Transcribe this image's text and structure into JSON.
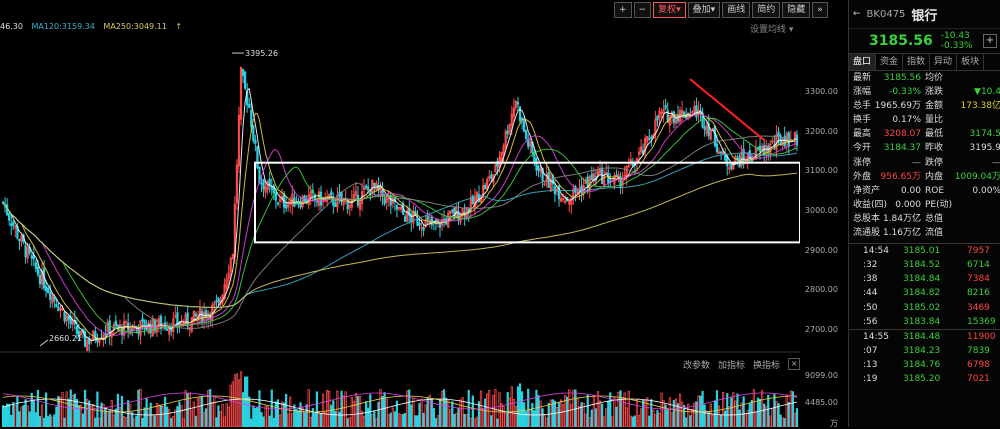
{
  "ma_labels": [
    {
      "text": "46.30",
      "color": "#e0e0e0"
    },
    {
      "text": "MA120:3159.34",
      "color": "#3bb3c9"
    },
    {
      "text": "MA250:3049.11",
      "color": "#d8cc60"
    },
    {
      "text": "↑",
      "color": "#d8cc60"
    }
  ],
  "toolbar": {
    "plus": "+",
    "minus": "−",
    "fq": "复权",
    "fq_arrow": "▾",
    "overlay": "叠加",
    "overlay_arrow": "▾",
    "line": "画线",
    "simple": "简约",
    "hide": "隐藏",
    "more": "»"
  },
  "settings_label": "设置均线 ▾",
  "high_label": "3395.26",
  "low_label": "2660.21",
  "price_ticks": [
    "3300.00",
    "3200.00",
    "3100.00",
    "3000.00",
    "2900.00",
    "2800.00",
    "2700.00"
  ],
  "volume_ticks": [
    "9099.00",
    "4485.00",
    "万"
  ],
  "sub_toolbar": {
    "params": "改参数",
    "add": "加指标",
    "switch": "换指标",
    "close": "×"
  },
  "panel": {
    "back_icon": "←",
    "code": "BK0475",
    "name": "银行",
    "price": "3185.56",
    "change": "-10.43",
    "change_pct": "-0.33%",
    "plus": "+",
    "tabs": [
      "盘口",
      "资金",
      "指数",
      "异动",
      "板块"
    ],
    "rows": [
      {
        "l1": "最新",
        "v1": "3185.56",
        "c1": "grn",
        "l2": "均价",
        "v2": "",
        "c2": "wht"
      },
      {
        "l1": "涨幅",
        "v1": "-0.33%",
        "c1": "grn",
        "l2": "涨跌",
        "v2": "▼10.4",
        "c2": "grn"
      },
      {
        "l1": "总手",
        "v1": "1965.69万",
        "c1": "wht",
        "l2": "金额",
        "v2": "173.38亿",
        "c2": "yel"
      },
      {
        "l1": "换手",
        "v1": "0.17%",
        "c1": "wht",
        "l2": "量比",
        "v2": "",
        "c2": "wht"
      },
      {
        "l1": "最高",
        "v1": "3208.07",
        "c1": "red",
        "l2": "最低",
        "v2": "3174.5",
        "c2": "grn"
      },
      {
        "l1": "今开",
        "v1": "3184.37",
        "c1": "grn",
        "l2": "昨收",
        "v2": "3195.9",
        "c2": "wht"
      },
      {
        "l1": "涨停",
        "v1": "—",
        "c1": "gry",
        "l2": "跌停",
        "v2": "—",
        "c2": "gry"
      },
      {
        "l1": "外盘",
        "v1": "956.65万",
        "c1": "red",
        "l2": "内盘",
        "v2": "1009.04万",
        "c2": "grn"
      },
      {
        "l1": "净资产",
        "v1": "0.00",
        "c1": "wht",
        "l2": "ROE",
        "v2": "0.00%",
        "c2": "wht"
      },
      {
        "l1": "收益(四)",
        "v1": "0.000",
        "c1": "wht",
        "l2": "PE(动)",
        "v2": "",
        "c2": "wht"
      },
      {
        "l1": "总股本",
        "v1": "1.84万亿",
        "c1": "wht",
        "l2": "总值",
        "v2": "",
        "c2": "wht"
      },
      {
        "l1": "流通股",
        "v1": "1.16万亿",
        "c1": "wht",
        "l2": "流值",
        "v2": "",
        "c2": "wht"
      }
    ],
    "ticks": [
      {
        "t": "14:54",
        "p": "3185.01",
        "v": "7957",
        "pc": "grn",
        "vc": "red"
      },
      {
        "t": ":32",
        "p": "3184.52",
        "v": "6714",
        "pc": "grn",
        "vc": "grn"
      },
      {
        "t": ":38",
        "p": "3184.84",
        "v": "7384",
        "pc": "grn",
        "vc": "red"
      },
      {
        "t": ":44",
        "p": "3184.82",
        "v": "8216",
        "pc": "grn",
        "vc": "grn"
      },
      {
        "t": ":50",
        "p": "3185.02",
        "v": "3469",
        "pc": "grn",
        "vc": "red"
      },
      {
        "t": ":56",
        "p": "3183.84",
        "v": "15369",
        "pc": "grn",
        "vc": "grn"
      },
      {
        "t": "14:55",
        "p": "3184.48",
        "v": "11900",
        "pc": "grn",
        "vc": "red"
      },
      {
        "t": ":07",
        "p": "3184.23",
        "v": "7839",
        "pc": "grn",
        "vc": "grn"
      },
      {
        "t": ":13",
        "p": "3184.76",
        "v": "6798",
        "pc": "grn",
        "vc": "red"
      },
      {
        "t": ":19",
        "p": "3185.20",
        "v": "7021",
        "pc": "grn",
        "vc": "red"
      }
    ]
  },
  "chart_data": {
    "type": "candlestick",
    "title": "",
    "y_range": [
      2620,
      3430
    ],
    "annotations": {
      "high": 3395.26,
      "low": 2660.21
    },
    "box_range": [
      2920,
      3120
    ],
    "trend_line": {
      "from": 3330,
      "to": 3175
    },
    "colors": {
      "up": "#ff4a4a",
      "down": "#2ad1e0",
      "ma120": "#3bb3c9",
      "ma250": "#d8cc60",
      "box": "#ffffff",
      "trend": "#ff2020"
    }
  }
}
